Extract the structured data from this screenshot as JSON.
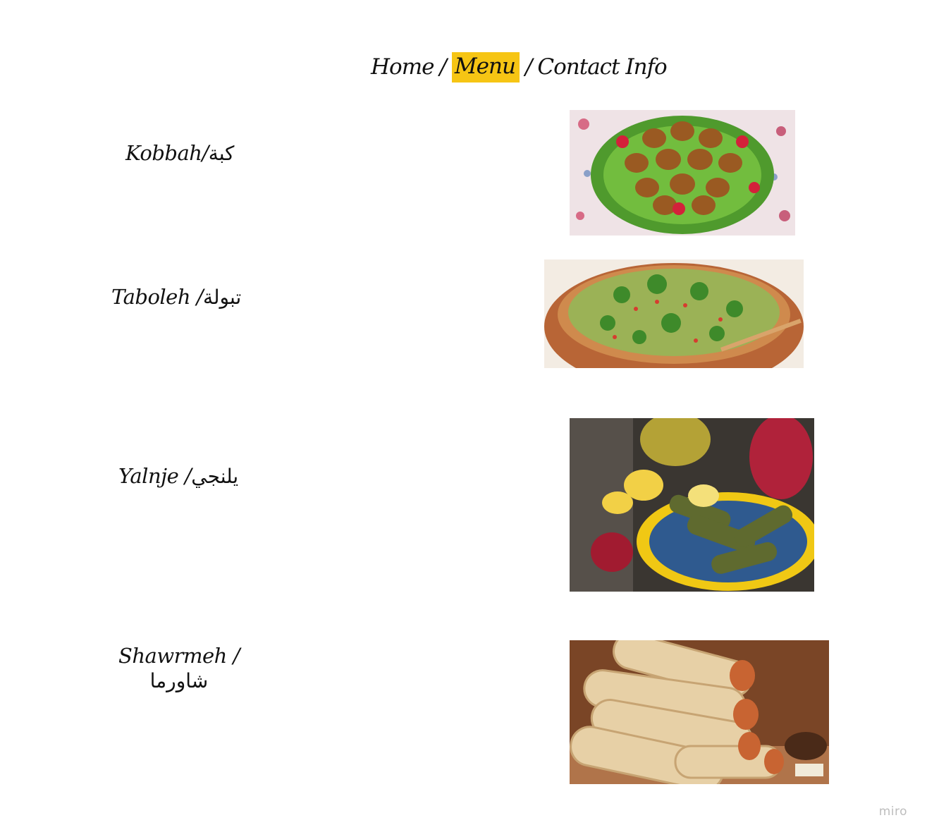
{
  "nav": {
    "home": "Home",
    "sep1": "/",
    "menu": "Menu",
    "sep2": "/",
    "contact": "Contact Info"
  },
  "dishes": [
    {
      "label_en": "Kobbah/",
      "label_ar": "كبة",
      "icon": "kibbeh-photo"
    },
    {
      "label_en": "Taboleh /",
      "label_ar": "تبولة",
      "icon": "tabbouleh-photo"
    },
    {
      "label_en": "Yalnje /",
      "label_ar": "يلنجي",
      "icon": "stuffed-grape-leaves-photo"
    },
    {
      "label_en": "Shawrmeh /",
      "label_ar": "شاورما",
      "icon": "shawarma-photo"
    }
  ],
  "watermark": "miro",
  "colors": {
    "active_highlight": "#f6c514"
  }
}
